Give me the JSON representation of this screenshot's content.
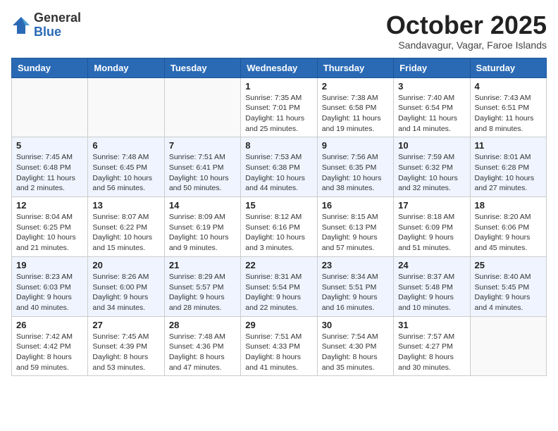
{
  "logo": {
    "general": "General",
    "blue": "Blue"
  },
  "header": {
    "month": "October 2025",
    "location": "Sandavagur, Vagar, Faroe Islands"
  },
  "weekdays": [
    "Sunday",
    "Monday",
    "Tuesday",
    "Wednesday",
    "Thursday",
    "Friday",
    "Saturday"
  ],
  "weeks": [
    [
      {
        "day": "",
        "info": ""
      },
      {
        "day": "",
        "info": ""
      },
      {
        "day": "",
        "info": ""
      },
      {
        "day": "1",
        "info": "Sunrise: 7:35 AM\nSunset: 7:01 PM\nDaylight: 11 hours\nand 25 minutes."
      },
      {
        "day": "2",
        "info": "Sunrise: 7:38 AM\nSunset: 6:58 PM\nDaylight: 11 hours\nand 19 minutes."
      },
      {
        "day": "3",
        "info": "Sunrise: 7:40 AM\nSunset: 6:54 PM\nDaylight: 11 hours\nand 14 minutes."
      },
      {
        "day": "4",
        "info": "Sunrise: 7:43 AM\nSunset: 6:51 PM\nDaylight: 11 hours\nand 8 minutes."
      }
    ],
    [
      {
        "day": "5",
        "info": "Sunrise: 7:45 AM\nSunset: 6:48 PM\nDaylight: 11 hours\nand 2 minutes."
      },
      {
        "day": "6",
        "info": "Sunrise: 7:48 AM\nSunset: 6:45 PM\nDaylight: 10 hours\nand 56 minutes."
      },
      {
        "day": "7",
        "info": "Sunrise: 7:51 AM\nSunset: 6:41 PM\nDaylight: 10 hours\nand 50 minutes."
      },
      {
        "day": "8",
        "info": "Sunrise: 7:53 AM\nSunset: 6:38 PM\nDaylight: 10 hours\nand 44 minutes."
      },
      {
        "day": "9",
        "info": "Sunrise: 7:56 AM\nSunset: 6:35 PM\nDaylight: 10 hours\nand 38 minutes."
      },
      {
        "day": "10",
        "info": "Sunrise: 7:59 AM\nSunset: 6:32 PM\nDaylight: 10 hours\nand 32 minutes."
      },
      {
        "day": "11",
        "info": "Sunrise: 8:01 AM\nSunset: 6:28 PM\nDaylight: 10 hours\nand 27 minutes."
      }
    ],
    [
      {
        "day": "12",
        "info": "Sunrise: 8:04 AM\nSunset: 6:25 PM\nDaylight: 10 hours\nand 21 minutes."
      },
      {
        "day": "13",
        "info": "Sunrise: 8:07 AM\nSunset: 6:22 PM\nDaylight: 10 hours\nand 15 minutes."
      },
      {
        "day": "14",
        "info": "Sunrise: 8:09 AM\nSunset: 6:19 PM\nDaylight: 10 hours\nand 9 minutes."
      },
      {
        "day": "15",
        "info": "Sunrise: 8:12 AM\nSunset: 6:16 PM\nDaylight: 10 hours\nand 3 minutes."
      },
      {
        "day": "16",
        "info": "Sunrise: 8:15 AM\nSunset: 6:13 PM\nDaylight: 9 hours\nand 57 minutes."
      },
      {
        "day": "17",
        "info": "Sunrise: 8:18 AM\nSunset: 6:09 PM\nDaylight: 9 hours\nand 51 minutes."
      },
      {
        "day": "18",
        "info": "Sunrise: 8:20 AM\nSunset: 6:06 PM\nDaylight: 9 hours\nand 45 minutes."
      }
    ],
    [
      {
        "day": "19",
        "info": "Sunrise: 8:23 AM\nSunset: 6:03 PM\nDaylight: 9 hours\nand 40 minutes."
      },
      {
        "day": "20",
        "info": "Sunrise: 8:26 AM\nSunset: 6:00 PM\nDaylight: 9 hours\nand 34 minutes."
      },
      {
        "day": "21",
        "info": "Sunrise: 8:29 AM\nSunset: 5:57 PM\nDaylight: 9 hours\nand 28 minutes."
      },
      {
        "day": "22",
        "info": "Sunrise: 8:31 AM\nSunset: 5:54 PM\nDaylight: 9 hours\nand 22 minutes."
      },
      {
        "day": "23",
        "info": "Sunrise: 8:34 AM\nSunset: 5:51 PM\nDaylight: 9 hours\nand 16 minutes."
      },
      {
        "day": "24",
        "info": "Sunrise: 8:37 AM\nSunset: 5:48 PM\nDaylight: 9 hours\nand 10 minutes."
      },
      {
        "day": "25",
        "info": "Sunrise: 8:40 AM\nSunset: 5:45 PM\nDaylight: 9 hours\nand 4 minutes."
      }
    ],
    [
      {
        "day": "26",
        "info": "Sunrise: 7:42 AM\nSunset: 4:42 PM\nDaylight: 8 hours\nand 59 minutes."
      },
      {
        "day": "27",
        "info": "Sunrise: 7:45 AM\nSunset: 4:39 PM\nDaylight: 8 hours\nand 53 minutes."
      },
      {
        "day": "28",
        "info": "Sunrise: 7:48 AM\nSunset: 4:36 PM\nDaylight: 8 hours\nand 47 minutes."
      },
      {
        "day": "29",
        "info": "Sunrise: 7:51 AM\nSunset: 4:33 PM\nDaylight: 8 hours\nand 41 minutes."
      },
      {
        "day": "30",
        "info": "Sunrise: 7:54 AM\nSunset: 4:30 PM\nDaylight: 8 hours\nand 35 minutes."
      },
      {
        "day": "31",
        "info": "Sunrise: 7:57 AM\nSunset: 4:27 PM\nDaylight: 8 hours\nand 30 minutes."
      },
      {
        "day": "",
        "info": ""
      }
    ]
  ]
}
